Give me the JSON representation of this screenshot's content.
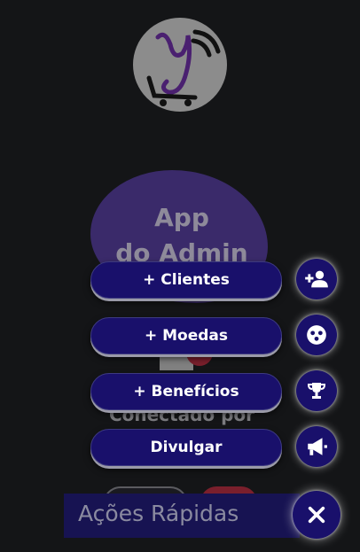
{
  "background_page": {
    "app_title_line1": "App",
    "app_title_line2": "do Admin",
    "connected_label": "Conectado por"
  },
  "speed_dial": {
    "actions": [
      {
        "label": "+ Clientes",
        "icon": "person-add-icon"
      },
      {
        "label": "+ Moedas",
        "icon": "coins-icon"
      },
      {
        "label": "+ Benefícios",
        "icon": "trophy-icon"
      },
      {
        "label": "Divulgar",
        "icon": "megaphone-icon"
      }
    ],
    "main_label": "Ações Rápidas",
    "main_icon": "close-icon"
  },
  "colors": {
    "page_background": "#141517",
    "action_background": "#19106b",
    "blob": "#3a2a6a",
    "accent_red": "#7a1f2c"
  }
}
